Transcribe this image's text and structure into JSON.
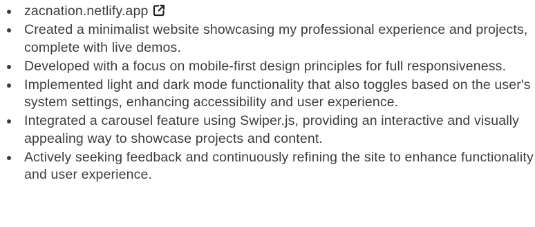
{
  "project": {
    "link_text": "zacnation.netlify.app",
    "link_icon": "external-link-icon",
    "bullets": [
      "Created a minimalist website showcasing my professional experience and projects, complete with live demos.",
      "Developed with a focus on mobile-first design principles for full responsiveness.",
      "Implemented light and dark mode functionality that also toggles based on the user's system settings, enhancing accessibility and user experience.",
      "Integrated a carousel feature using Swiper.js, providing an interactive and visually appealing way to showcase projects and content.",
      "Actively seeking feedback and continuously refining the site to enhance functionality and user experience."
    ]
  },
  "colors": {
    "text": "#3c3c3c",
    "background": "#ffffff"
  }
}
